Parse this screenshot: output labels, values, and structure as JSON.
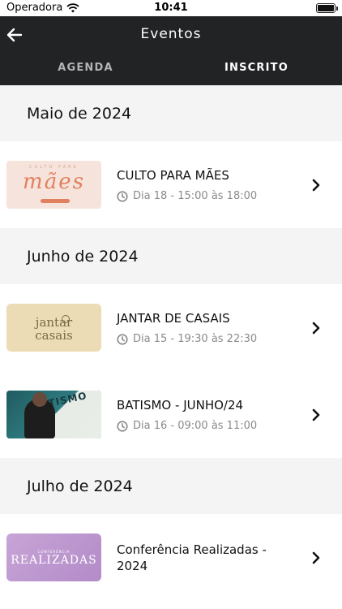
{
  "status_bar": {
    "carrier": "Operadora",
    "time": "10:41",
    "battery_level": 1.0
  },
  "app_bar": {
    "title": "Eventos",
    "back_icon": "arrow-left-icon"
  },
  "tabs": [
    {
      "label": "AGENDA",
      "selected": false
    },
    {
      "label": "INSCRITO",
      "selected": true
    }
  ],
  "months": [
    {
      "label": "Maio de 2024",
      "events": [
        {
          "title": "CULTO PARA MÃES",
          "time": "Dia 18 - 15:00 às 18:00",
          "thumb_small": "CULTO PARA",
          "thumb_big": "mães"
        }
      ]
    },
    {
      "label": "Junho de 2024",
      "events": [
        {
          "title": "JANTAR DE CASAIS",
          "time": "Dia 15 - 19:30 às 22:30",
          "thumb_line1": "jantar",
          "thumb_line2": "casais"
        },
        {
          "title": "BATISMO - JUNHO/24",
          "time": "Dia 16 - 09:00 às 11:00",
          "thumb_text": "BATISMO"
        }
      ]
    },
    {
      "label": "Julho de 2024",
      "events": [
        {
          "title": "Conferência Realizadas - 2024",
          "time": "",
          "thumb_line1": "CONFERÊNCIA",
          "thumb_line2": "REALIZADAS"
        }
      ]
    }
  ],
  "colors": {
    "appbar_bg": "#222325",
    "month_bg": "#f4f4f4",
    "muted_text": "#8a8a8a"
  }
}
